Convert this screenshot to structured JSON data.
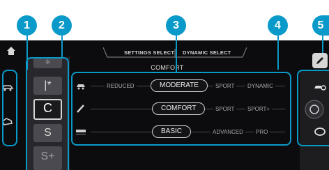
{
  "callouts": [
    "1",
    "2",
    "3",
    "4",
    "5"
  ],
  "header": {
    "tab_left": "SETTINGS SELECT",
    "tab_right": "DYNAMIC SELECT",
    "title": "COMFORT"
  },
  "drive_modes": {
    "top": "✲",
    "item1": "|*",
    "item2": "C",
    "item3": "S",
    "item4": "S+",
    "selected": "C"
  },
  "rows": [
    {
      "name": "drivetrain",
      "options": [
        "REDUCED",
        "MODERATE",
        "SPORT",
        "DYNAMIC"
      ],
      "selected": "MODERATE"
    },
    {
      "name": "suspension",
      "options": [
        "COMFORT",
        "SPORT",
        "SPORT+"
      ],
      "selected": "COMFORT"
    },
    {
      "name": "amg-dynamics",
      "options": [
        "BASIC",
        "ADVANCED",
        "PRO"
      ],
      "selected": "BASIC"
    }
  ],
  "colors": {
    "accent": "#0a9ac9",
    "screen_bg": "#0c0c0e",
    "text": "#a8a8ae"
  },
  "icons": [
    "home-icon",
    "pencil-icon",
    "car-settings-icon",
    "steering-wheel-icon",
    "damper-icon",
    "amg-dynamics-icon"
  ]
}
